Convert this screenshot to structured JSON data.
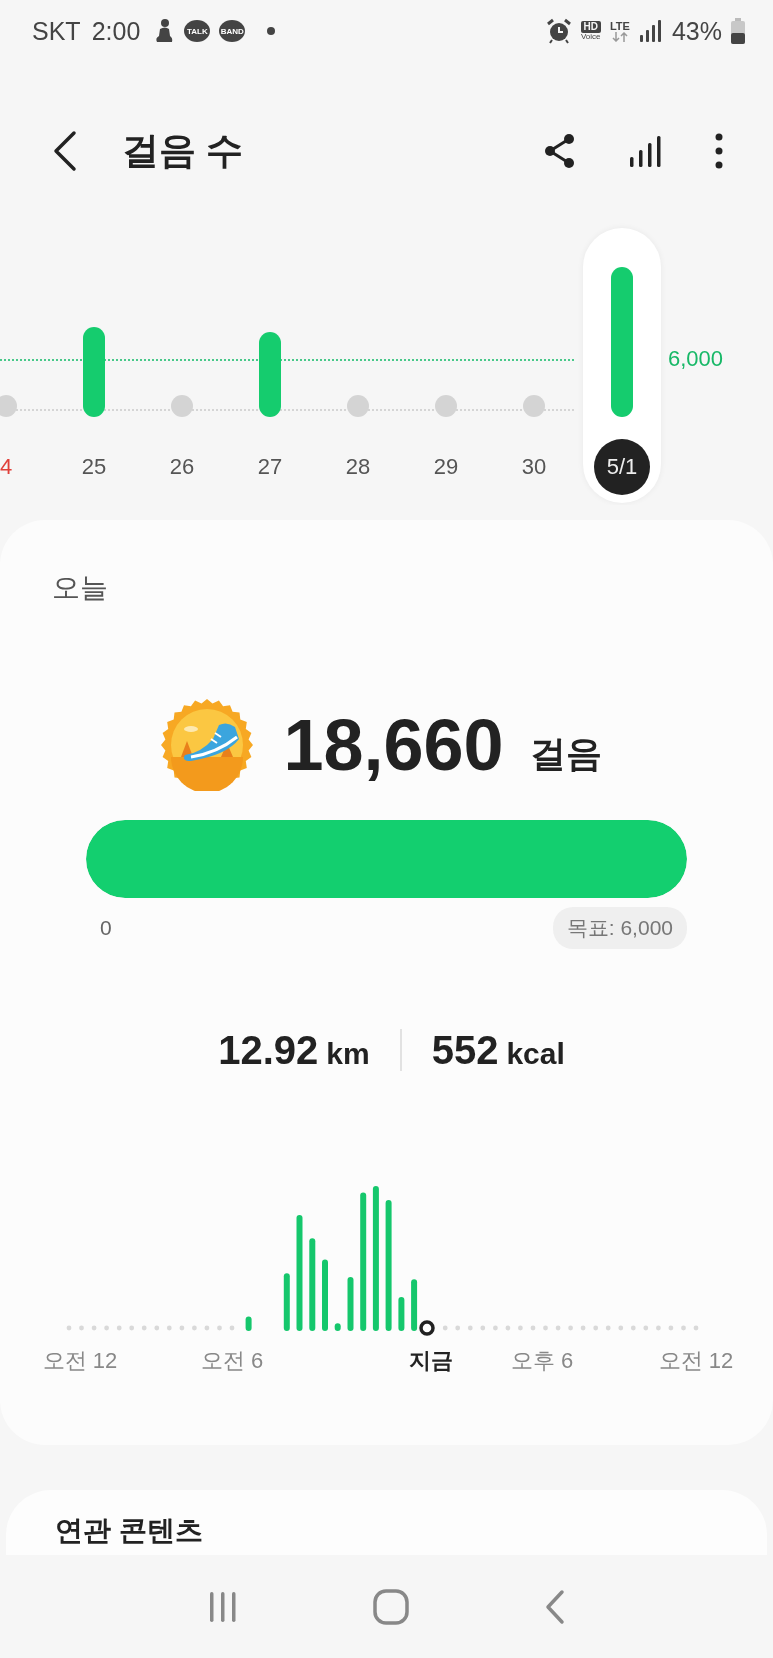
{
  "status_bar": {
    "carrier": "SKT",
    "time": "2:00",
    "notifications": [
      {
        "kind": "figure"
      },
      {
        "kind": "bubble",
        "text": "TALK"
      },
      {
        "kind": "bubble",
        "text": "BAND"
      },
      {
        "kind": "dot"
      }
    ],
    "hd": "HD",
    "voice": "Voice",
    "network": "LTE",
    "battery": "43%"
  },
  "header": {
    "title": "걸음 수"
  },
  "daily_chart": {
    "goal_label": "6,000",
    "days": [
      {
        "label": "4",
        "kind": "sunday",
        "selected": false
      },
      {
        "label": "25",
        "kind": "weekday",
        "selected": false
      },
      {
        "label": "26",
        "kind": "weekday",
        "selected": false
      },
      {
        "label": "27",
        "kind": "weekday",
        "selected": false
      },
      {
        "label": "28",
        "kind": "weekday",
        "selected": false
      },
      {
        "label": "29",
        "kind": "weekday",
        "selected": false
      },
      {
        "label": "30",
        "kind": "weekday",
        "selected": false
      },
      {
        "label": "5/1",
        "kind": "weekday",
        "selected": true
      }
    ]
  },
  "today": {
    "label": "오늘",
    "steps": "18,660",
    "unit": "걸음",
    "level": 1,
    "min_label": "0",
    "goal_label": "목표: 6,000",
    "distance": "12.92",
    "distance_unit": "km",
    "calories": "552",
    "calories_unit": "kcal",
    "hour_labels": [
      {
        "text": "오전 12",
        "current": false
      },
      {
        "text": "오전 6",
        "current": false
      },
      {
        "text": "지금",
        "current": true
      },
      {
        "text": "오후 6",
        "current": false
      },
      {
        "text": "오전 12",
        "current": false
      }
    ]
  },
  "related": {
    "title": "연관 콘텐츠"
  }
}
